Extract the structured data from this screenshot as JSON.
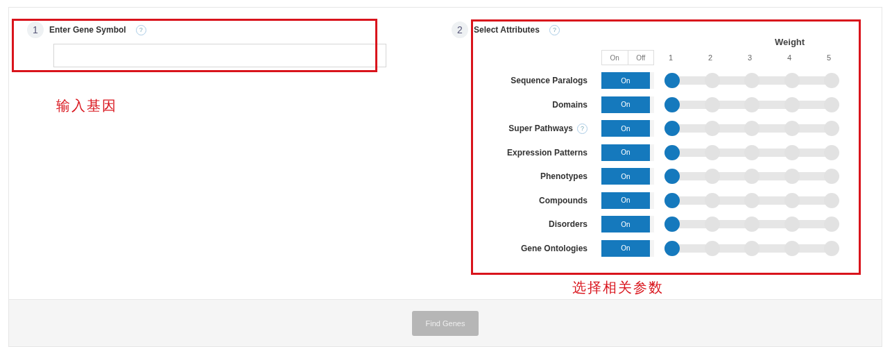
{
  "gene_step": {
    "number": "1",
    "label": "Enter Gene Symbol",
    "help": "?",
    "annotation": "输入基因"
  },
  "attributes_step": {
    "number": "2",
    "label": "Select Attributes",
    "help": "?",
    "annotation": "选择相关参数",
    "header": {
      "weight_label": "Weight",
      "toggle_labels": [
        "On",
        "Off"
      ],
      "ticks": [
        "1",
        "2",
        "3",
        "4",
        "5"
      ]
    },
    "rows": [
      {
        "name": "Sequence Paralogs",
        "on": true,
        "toggle_label": "On",
        "level": 0
      },
      {
        "name": "Domains",
        "on": true,
        "toggle_label": "On",
        "level": 0
      },
      {
        "name": "Super Pathways",
        "help": "?",
        "on": true,
        "toggle_label": "On",
        "level": 0
      },
      {
        "name": "Expression Patterns",
        "on": true,
        "toggle_label": "On",
        "level": 0
      },
      {
        "name": "Phenotypes",
        "on": true,
        "toggle_label": "On",
        "level": 0
      },
      {
        "name": "Compounds",
        "on": true,
        "toggle_label": "On",
        "level": 0
      },
      {
        "name": "Disorders",
        "on": true,
        "toggle_label": "On",
        "level": 0
      },
      {
        "name": "Gene Ontologies",
        "on": true,
        "toggle_label": "On",
        "level": 0
      }
    ]
  },
  "footer": {
    "button": {
      "label": "Find Genes",
      "disabled": true
    }
  }
}
